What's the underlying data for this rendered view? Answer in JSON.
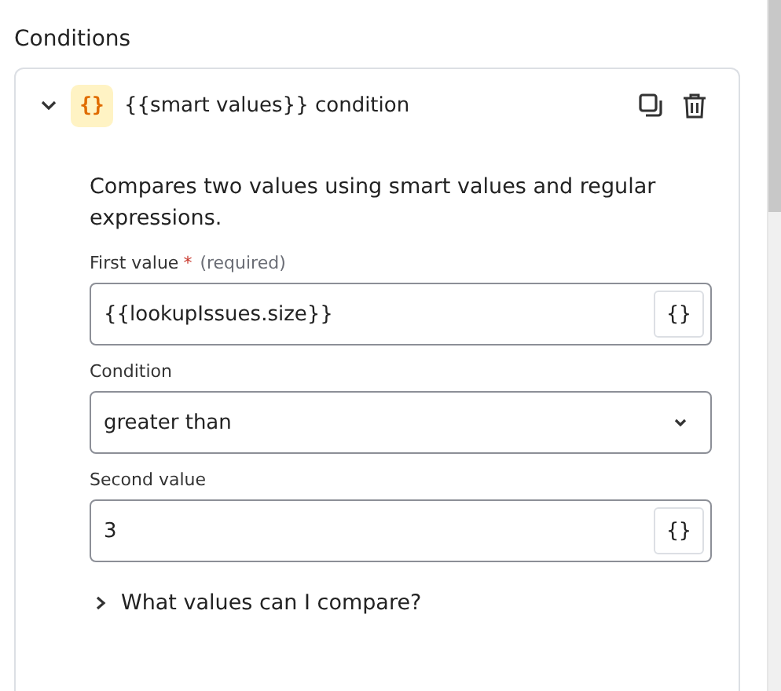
{
  "section_title": "Conditions",
  "condition": {
    "expanded": true,
    "badge": "{}",
    "title": "{{smart values}} condition",
    "description": "Compares two values using smart values and regular expressions.",
    "fields": [
      {
        "kind": "text",
        "label": "First value",
        "required_mark": "*",
        "required_note": "(required)",
        "value": "{{lookupIssues.size}}",
        "button": "{}"
      },
      {
        "kind": "select",
        "label": "Condition",
        "value": "greater than"
      },
      {
        "kind": "text",
        "label": "Second value",
        "value": "3",
        "button": "{}"
      }
    ],
    "help": {
      "expanded": false,
      "label": "What values can I compare?"
    }
  }
}
